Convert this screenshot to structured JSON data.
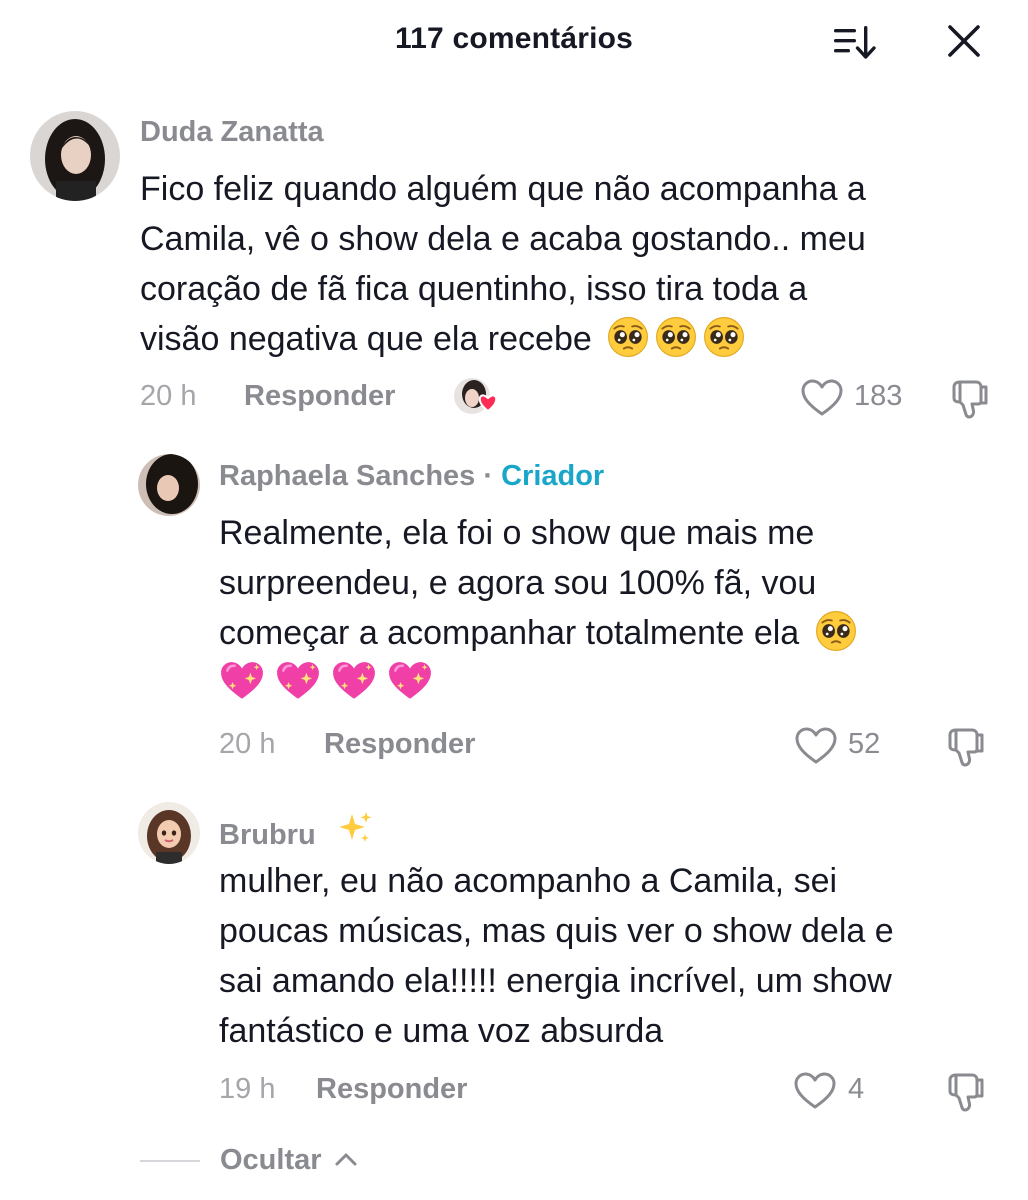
{
  "header": {
    "title": "117 comentários"
  },
  "comments": [
    {
      "username": "Duda Zanatta",
      "lines": [
        "Fico feliz quando alguém que não acompanha a",
        "Camila, vê o show dela e acaba gostando.. meu",
        "coração de fã fica quentinho, isso tira toda a",
        "visão negativa que ela recebe"
      ],
      "emojis": "🥺🥺🥺",
      "time": "20 h",
      "reply_label": "Responder",
      "likes": "183",
      "creator_liked": true
    },
    {
      "username": "Raphaela Sanches",
      "separator": "·",
      "badge": "Criador",
      "lines": [
        "Realmente, ela foi o show que mais me",
        "surpreendeu, e agora sou 100% fã, vou",
        "começar a acompanhar totalmente ela"
      ],
      "emojis_inline": "🥺",
      "emojis_row": "💖💖💖💖",
      "time": "20 h",
      "reply_label": "Responder",
      "likes": "52"
    },
    {
      "username": "Brubru",
      "username_emoji": "✨",
      "lines": [
        "mulher, eu não acompanho a Camila, sei",
        "poucas músicas, mas quis ver o show dela e",
        "sai amando ela!!!!! energia incrível, um show",
        "fantástico e uma voz absurda"
      ],
      "time": "19 h",
      "reply_label": "Responder",
      "likes": "4"
    }
  ],
  "footer": {
    "hide_label": "Ocultar"
  },
  "icons": {
    "sort": "sort-icon",
    "close": "close-icon",
    "like": "heart-outline-icon",
    "dislike": "thumbs-down-icon",
    "creator_heart": "creator-liked-heart-icon",
    "chevron": "chevron-up-icon",
    "pleading": "pleading-face-icon",
    "sparkling_heart": "sparkling-heart-icon",
    "sparkles": "sparkles-icon"
  },
  "colors": {
    "text": "#161823",
    "muted": "#8a8b91",
    "creator": "#1aa6c9",
    "heart_red": "#fe2c55"
  }
}
